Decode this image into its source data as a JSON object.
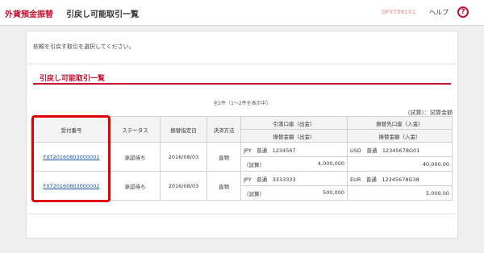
{
  "header": {
    "brand": "外貨預金振替",
    "title": "引戻し可能取引一覧",
    "screen_id": "GFXT08101",
    "help_label": "ヘルプ",
    "help_icon": "?"
  },
  "main": {
    "instruction": "依頼を引戻す取引を選択してください。",
    "section_title": "引戻し可能取引一覧",
    "count_text": "全2件（1～2件を表示中）",
    "unit_note": "（試算）：試算金額"
  },
  "table": {
    "headers": {
      "receipt_no": "受付番号",
      "status": "ステータス",
      "transfer_date": "振替指定日",
      "rate_method": "決済方法",
      "debit_account": "引落口座（出金）",
      "debit_amount": "振替金額（出金）",
      "credit_account": "振替先口座（入金）",
      "credit_amount": "振替金額（入金）"
    },
    "rows": [
      {
        "receipt_no": "FXT20160803000001",
        "status": "承認待ち",
        "transfer_date": "2016/08/03",
        "rate_method": "直物",
        "debit_account": "JPY　普通　1234567",
        "debit_amount_label": "（試算）",
        "debit_amount": "4,000,000",
        "credit_account": "USD　普通　12345678G01",
        "credit_amount": "40,000.00"
      },
      {
        "receipt_no": "FXT20160803000002",
        "status": "承認待ち",
        "transfer_date": "2016/08/03",
        "rate_method": "直物",
        "debit_account": "JPY　普通　3333333",
        "debit_amount_label": "（試算）",
        "debit_amount": "500,000",
        "credit_account": "EUR　普通　12345678G38",
        "credit_amount": "5,000.00"
      }
    ]
  },
  "colors": {
    "accent": "#c8102e",
    "highlight": "#e00000",
    "link": "#1a55a8"
  }
}
